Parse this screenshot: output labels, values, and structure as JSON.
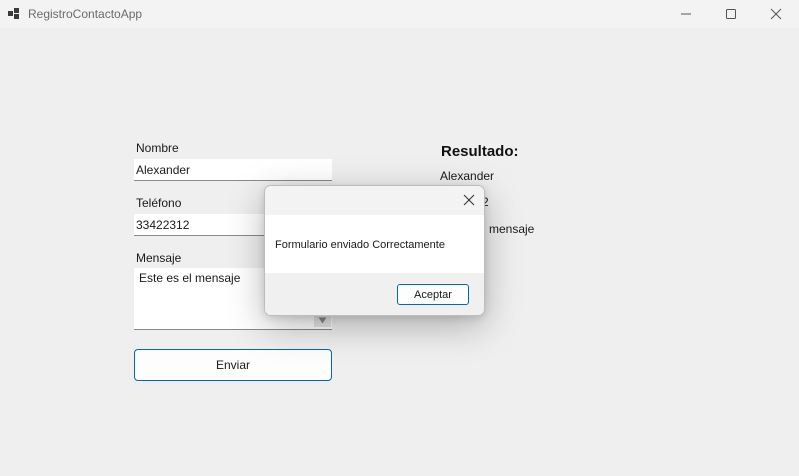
{
  "window": {
    "title": "RegistroContactoApp"
  },
  "form": {
    "name_label": "Nombre",
    "name_value": "Alexander",
    "phone_label": "Teléfono",
    "phone_value": "33422312",
    "message_label": "Mensaje",
    "message_value": "Este es el mensaje",
    "send_label": "Enviar"
  },
  "result": {
    "title": "Resultado:",
    "name": "Alexander",
    "phone_partial": "2",
    "message_partial": "l mensaje"
  },
  "dialog": {
    "message": "Formulario enviado Correctamente",
    "ok_label": "Aceptar"
  },
  "icons": {
    "app": "app-icon",
    "minimize": "minimize-icon",
    "maximize": "maximize-icon",
    "close": "close-icon",
    "dialog_close": "close-icon",
    "scroll": "scroll-down-icon"
  },
  "colors": {
    "accent": "#0067c0",
    "background": "#efefef",
    "dialog_bg": "#ffffff"
  }
}
